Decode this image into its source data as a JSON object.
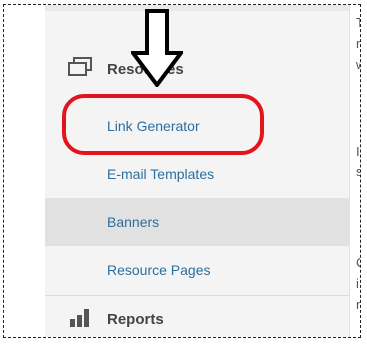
{
  "sidebar": {
    "resources_label": "Resources",
    "items": [
      {
        "label": "Link Generator",
        "highlighted": true
      },
      {
        "label": "E-mail Templates"
      },
      {
        "label": "Banners",
        "active": true
      },
      {
        "label": "Resource Pages"
      }
    ],
    "reports_label": "Reports"
  },
  "right_panel": {
    "lines": [
      "T",
      "n",
      "w",
      "I",
      "s",
      "C",
      "i",
      "n"
    ]
  },
  "annotation": {
    "arrow_icon": "down-arrow-icon",
    "highlight_color": "#e3141c"
  },
  "colors": {
    "link": "#2d6e9e",
    "section_text": "#444444",
    "sidebar_bg": "#f4f4f4",
    "active_bg": "#e1e1e1"
  }
}
